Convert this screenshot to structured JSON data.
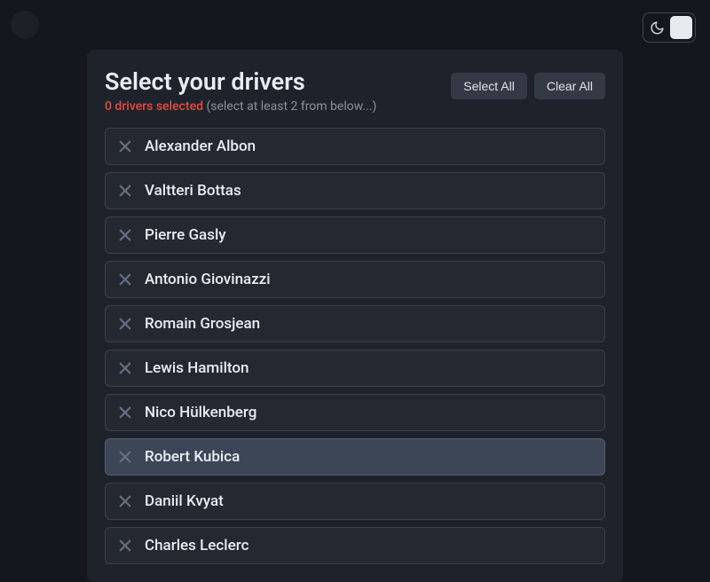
{
  "header": {
    "title": "Select your drivers",
    "count_text": "0 drivers selected",
    "hint_text": "(select at least 2 from below...)",
    "select_all_label": "Select All",
    "clear_all_label": "Clear All"
  },
  "drivers": [
    {
      "name": "Alexander Albon"
    },
    {
      "name": "Valtteri Bottas"
    },
    {
      "name": "Pierre Gasly"
    },
    {
      "name": "Antonio Giovinazzi"
    },
    {
      "name": "Romain Grosjean"
    },
    {
      "name": "Lewis Hamilton"
    },
    {
      "name": "Nico Hülkenberg"
    },
    {
      "name": "Robert Kubica"
    },
    {
      "name": "Daniil Kvyat"
    },
    {
      "name": "Charles Leclerc"
    }
  ],
  "hovered_index": 7
}
